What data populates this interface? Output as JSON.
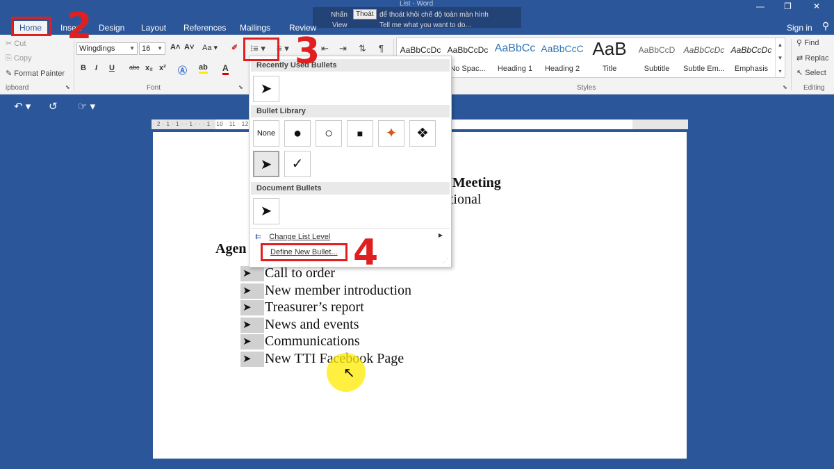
{
  "titlebar": {
    "ghost_title": "List - Word",
    "fullscreen_tip": {
      "press": "Nhấn",
      "exit_btn": "Thoát",
      "text": "để thoát khỏi chế độ toàn màn hình",
      "view": "View",
      "tell_me": "Tell me what you want to do..."
    },
    "tabs": [
      "Home",
      "Insert",
      "Design",
      "Layout",
      "References",
      "Mailings",
      "Review"
    ],
    "signin": "Sign in"
  },
  "ribbon": {
    "clipboard": {
      "cut": "Cut",
      "copy": "Copy",
      "format_painter": "Format Painter",
      "label": "ipboard"
    },
    "font": {
      "name": "Wingdings",
      "size": "16",
      "label": "Font",
      "buttons": [
        "B",
        "I",
        "U",
        "abc",
        "x₂",
        "x²"
      ]
    },
    "styles": {
      "label": "Styles",
      "items": [
        {
          "preview": "AaBbCcDc",
          "name": ""
        },
        {
          "preview": "AaBbCcDc",
          "name": "No Spac..."
        },
        {
          "preview": "AaBbCc",
          "name": "Heading 1"
        },
        {
          "preview": "AaBbCcC",
          "name": "Heading 2"
        },
        {
          "preview": "AaB",
          "name": "Title"
        },
        {
          "preview": "AaBbCcD",
          "name": "Subtitle"
        },
        {
          "preview": "AaBbCcDc",
          "name": "Subtle Em..."
        },
        {
          "preview": "AaBbCcDc",
          "name": "Emphasis"
        }
      ]
    },
    "editing": {
      "find": "Find",
      "replace": "Replac",
      "select": "Select",
      "label": "Editing"
    }
  },
  "ruler": "· 2 · 1 · 1 · · 1 · · · 1 · 10 · 11 · 12 · 13 · 14 · 15 · 16 · 17 · 18 · 19",
  "document": {
    "title_fragment": "s Meeting",
    "subtitle_fragment": "ational",
    "agenda_fragment": "Agen",
    "items": [
      "Call to order",
      "New member introduction",
      "Treasurer’s report",
      "News and events",
      "Communications",
      "New TTI Facebook Page"
    ]
  },
  "bullet_menu": {
    "recent_header": "Recently Used Bullets",
    "library_header": "Bullet Library",
    "document_header": "Document Bullets",
    "none_label": "None",
    "library": [
      "●",
      "○",
      "■",
      "✦",
      "❖",
      "➤",
      "✓"
    ],
    "recent": [
      "➤"
    ],
    "document": [
      "➤"
    ],
    "change_level": "Change List Level",
    "define_new": "Define New Bullet..."
  },
  "steps": [
    "2",
    "3",
    "4"
  ],
  "colors": {
    "word_blue": "#2b579a",
    "annotation_red": "#e02020",
    "cursor_highlight": "#ffeb00"
  }
}
